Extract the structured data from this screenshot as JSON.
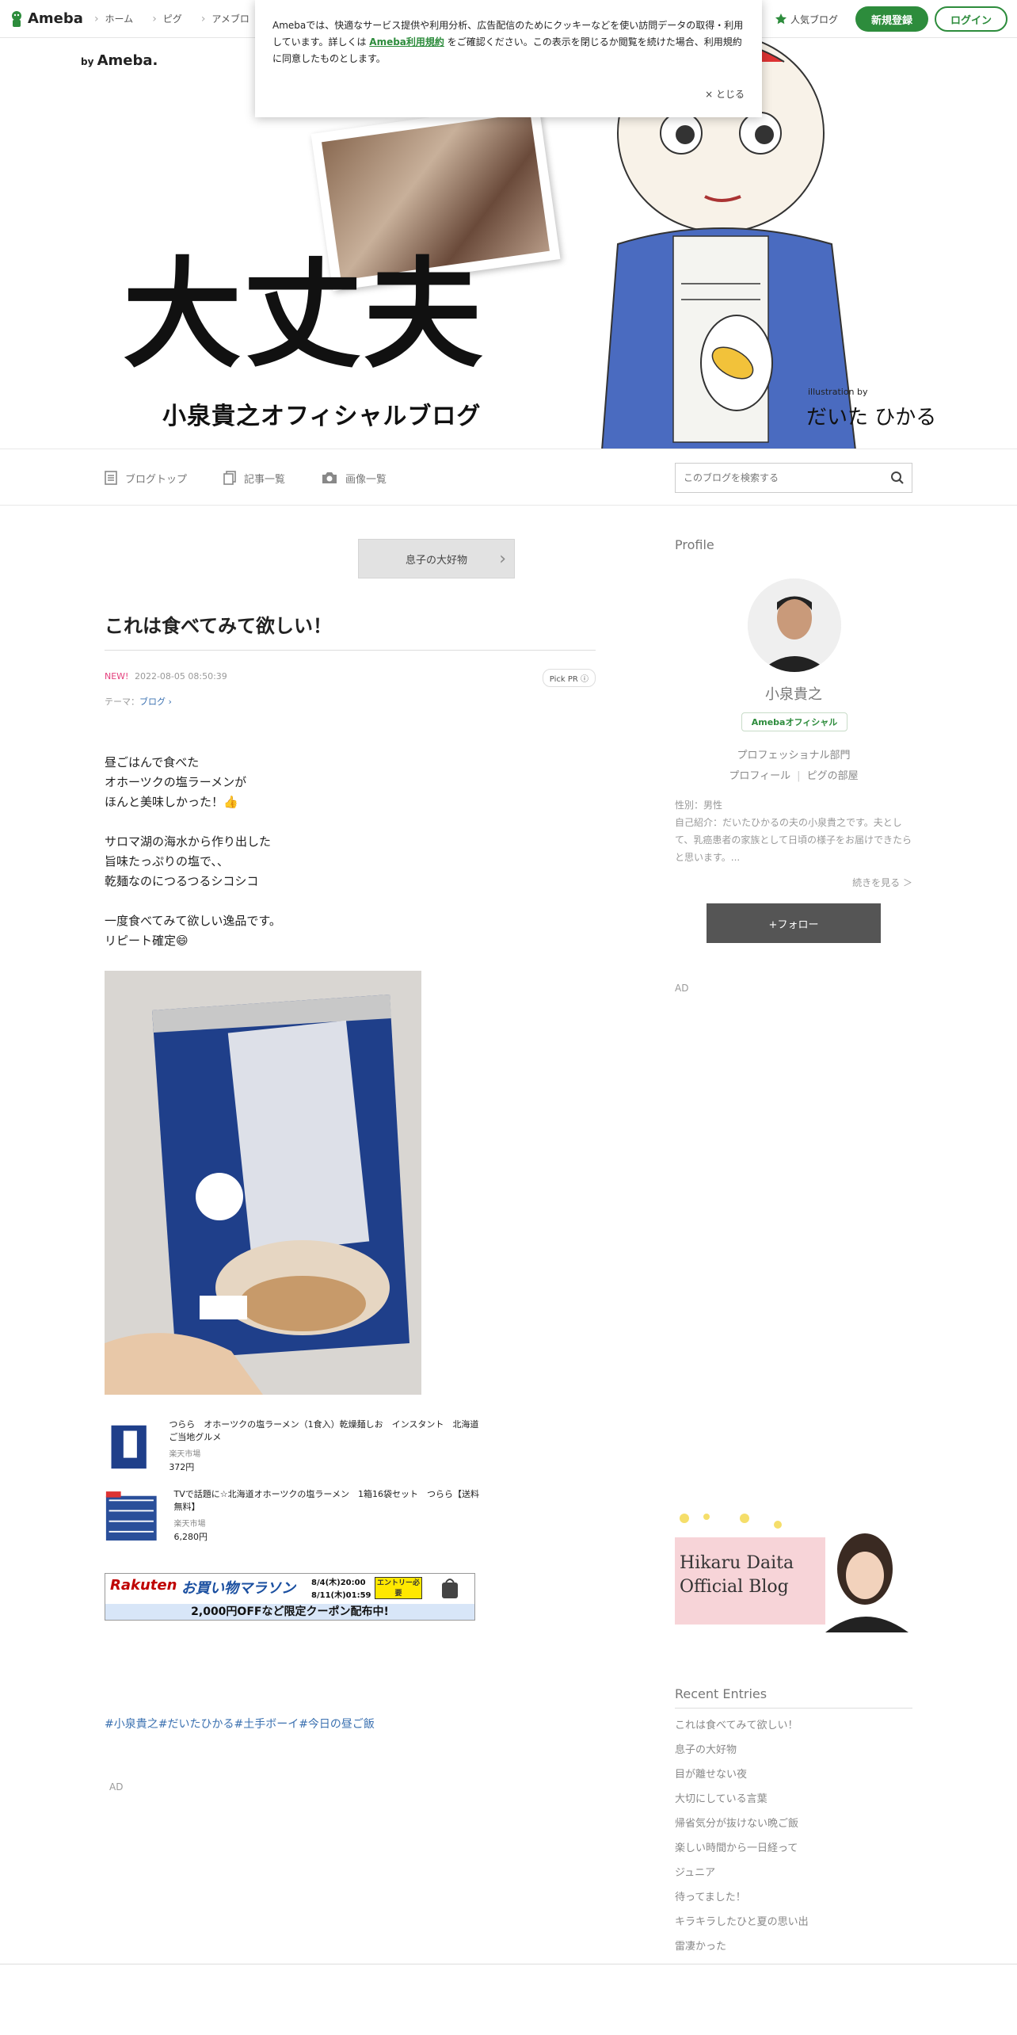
{
  "topbar": {
    "logo": "Ameba",
    "nav": [
      "ホーム",
      "ピグ",
      "アメブロ"
    ],
    "ranking": "人気ブログ",
    "register": "新規登録",
    "login": "ログイン"
  },
  "cookie": {
    "text_before": "Amebaでは、快適なサービス提供や利用分析、広告配信のためにクッキーなどを使い訪問データの取得・利用しています。詳しくは",
    "link": "Ameba利用規約",
    "text_after": "をご確認ください。この表示を閉じるか閲覧を続けた場合、利用規約に同意したものとします。",
    "close": "× とじる"
  },
  "header": {
    "by": "by",
    "by_brand": "Ameba.",
    "title": "大丈夫",
    "subtitle": "小泉貴之オフィシャルブログ",
    "illustration_by": "illustration by",
    "illustrator": "だいた ひかる"
  },
  "subnav": {
    "items": [
      "ブログトップ",
      "記事一覧",
      "画像一覧"
    ],
    "search_placeholder": "このブログを検索する"
  },
  "entry": {
    "prev_label": "息子の大好物",
    "title": "これは食べてみて欲しい！",
    "new_badge": "NEW!",
    "date": "2022-08-05 08:50:39",
    "pickpr": "Pick PR ⓘ",
    "theme_label": "テーマ：",
    "theme_link": "ブログ ›",
    "body": "昼ごはんで食べた\nオホーツクの塩ラーメンが\nほんと美味しかった！👍\n\nサロマ湖の海水から作り出した\n旨味たっぷりの塩で、、\n乾麺なのにつるつるシコシコ\n\n一度食べてみて欲しい逸品です。\nリピート確定😄",
    "products": [
      {
        "name": "つらら　オホーツクの塩ラーメン（1食入）乾燥麺しお　インスタント　北海道　ご当地グルメ",
        "shop": "楽天市場",
        "price": "372円"
      },
      {
        "name": "TVで話題に☆北海道オホーツクの塩ラーメン　1箱16袋セット　つらら【送料無料】",
        "shop": "楽天市場",
        "price": "6,280円"
      }
    ],
    "banner": {
      "brand": "Rakuten",
      "event": "お買い物マラソン",
      "dates1": "8/4(木)20:00",
      "dates2": "8/11(木)01:59",
      "entry": "エントリー必要",
      "bottom": "2,000円OFFなど限定クーポン配布中!"
    },
    "hashtags": [
      "#小泉貴之",
      "#だいたひかる",
      "#土手ボーイ",
      "#今日の昼ご飯"
    ],
    "ad": "AD"
  },
  "sidebar": {
    "profile_heading": "Profile",
    "name": "小泉貴之",
    "badge": "Amebaオフィシャル",
    "dept": "プロフェッショナル部門",
    "link1": "プロフィール",
    "link2": "ピグの部屋",
    "gender": "性別：男性",
    "intro": "自己紹介：だいたひかるの夫の小泉貴之です。夫として、乳癌患者の家族として日頃の様子をお届けできたらと思います。...",
    "more": "続きを見る ＞",
    "follow": "+フォロー",
    "ad": "AD",
    "hikaru_line1": "Hikaru Daita",
    "hikaru_line2": "Official Blog",
    "recent_heading": "Recent Entries",
    "recent": [
      "これは食べてみて欲しい！",
      "息子の大好物",
      "目が離せない夜",
      "大切にしている言葉",
      "帰省気分が抜けない晩ご飯",
      "楽しい時間から一日経って",
      "ジュニア",
      "待ってました！",
      "キラキラしたひと夏の思い出",
      "雷凄かった"
    ]
  }
}
